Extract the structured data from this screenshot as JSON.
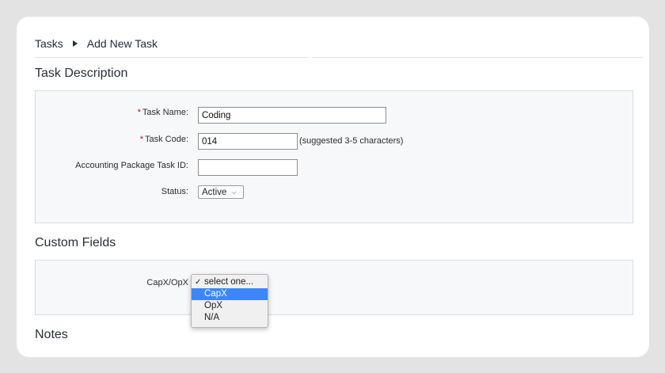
{
  "breadcrumb": {
    "root": "Tasks",
    "current": "Add New Task"
  },
  "sections": {
    "task_description": "Task Description",
    "custom_fields": "Custom Fields",
    "notes": "Notes"
  },
  "task_form": {
    "task_name": {
      "label": "Task Name:",
      "value": "Coding",
      "required": "*"
    },
    "task_code": {
      "label": "Task Code:",
      "value": "014",
      "required": "*",
      "hint": "(suggested 3-5 characters)"
    },
    "accounting_id": {
      "label": "Accounting Package Task ID:",
      "value": ""
    },
    "status": {
      "label": "Status:",
      "value": "Active"
    }
  },
  "custom_fields": {
    "capx_opx": {
      "label": "CapX/OpX",
      "options": [
        "select one...",
        "CapX",
        "OpX",
        "N/A"
      ],
      "checked": "select one...",
      "highlighted": "CapX"
    }
  },
  "icons": {
    "breadcrumb_separator": "triangle-right-icon",
    "status_dropdown": "chevron-down-icon",
    "check": "checkmark-icon"
  },
  "colors": {
    "required": "#d0021b",
    "highlight": "#3b86ff"
  }
}
